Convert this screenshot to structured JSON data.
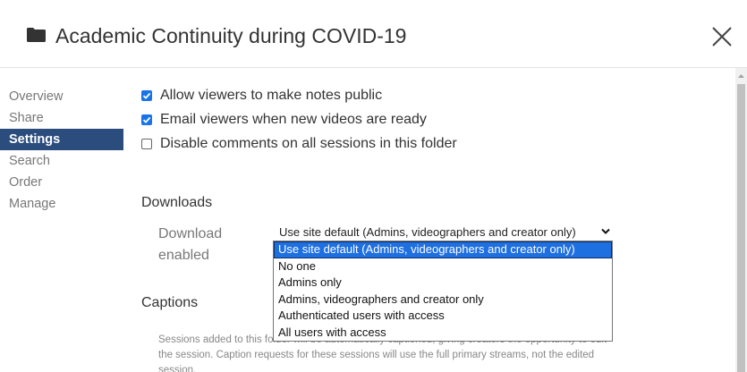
{
  "header": {
    "title": "Academic Continuity during COVID-19",
    "folder_icon": "folder-icon",
    "close_icon": "close-icon"
  },
  "sidebar": {
    "items": [
      {
        "label": "Overview",
        "active": false
      },
      {
        "label": "Share",
        "active": false
      },
      {
        "label": "Settings",
        "active": true
      },
      {
        "label": "Search",
        "active": false
      },
      {
        "label": "Order",
        "active": false
      },
      {
        "label": "Manage",
        "active": false
      }
    ],
    "active_color": "#2b4d7e"
  },
  "settings": {
    "checkboxes": [
      {
        "label": "Allow viewers to make notes public",
        "checked": true
      },
      {
        "label": "Email viewers when new videos are ready",
        "checked": true
      },
      {
        "label": "Disable comments on all sessions in this folder",
        "checked": false
      }
    ],
    "downloads": {
      "heading": "Downloads",
      "field_label": "Download enabled",
      "selected": "Use site default (Admins, videographers and creator only)",
      "options": [
        "Use site default (Admins, videographers and creator only)",
        "No one",
        "Admins only",
        "Admins, videographers and creator only",
        "Authenticated users with access",
        "All users with access"
      ]
    },
    "captions": {
      "heading": "Captions",
      "description": "Sessions added to this folder will be automatically captioned, giving creators the opportunity to edit the session. Caption requests for these sessions will use the full primary streams, not the edited session."
    }
  },
  "colors": {
    "checkbox_checked": "#1a73e8",
    "dropdown_highlight": "#1e6fe0"
  }
}
